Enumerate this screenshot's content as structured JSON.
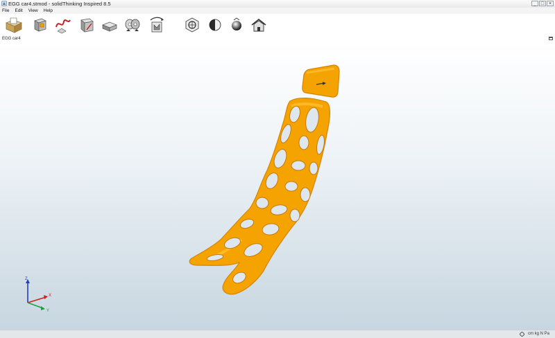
{
  "window": {
    "title": "EGG car4.stmod - solidThinking Inspired 8.5",
    "controls": [
      "_",
      "□",
      "×"
    ]
  },
  "menu": [
    {
      "label": "File"
    },
    {
      "label": "Edit"
    },
    {
      "label": "View"
    },
    {
      "label": "Help"
    }
  ],
  "toolbar": {
    "buttons": [
      "open-folder-icon",
      "design-space-icon",
      "shape-explorer-icon",
      "partition-icon",
      "extrude-icon",
      "pattern-symmetry-icon",
      "run-optimization-icon",
      "view-rotate-icon",
      "view-shading-icon",
      "view-sphere-icon",
      "home-view-icon"
    ]
  },
  "document": {
    "tab_title": "EGG car4"
  },
  "model": {
    "color": "#F5A300",
    "highlight": "#FFC23A",
    "shadow": "#D98300"
  },
  "triad": {
    "x_label": "X",
    "y_label": "Y",
    "z_label": "Z",
    "x_color": "#d02020",
    "y_color": "#20a040",
    "z_color": "#2040c0"
  },
  "status": {
    "units": "cm kg N Pa"
  }
}
